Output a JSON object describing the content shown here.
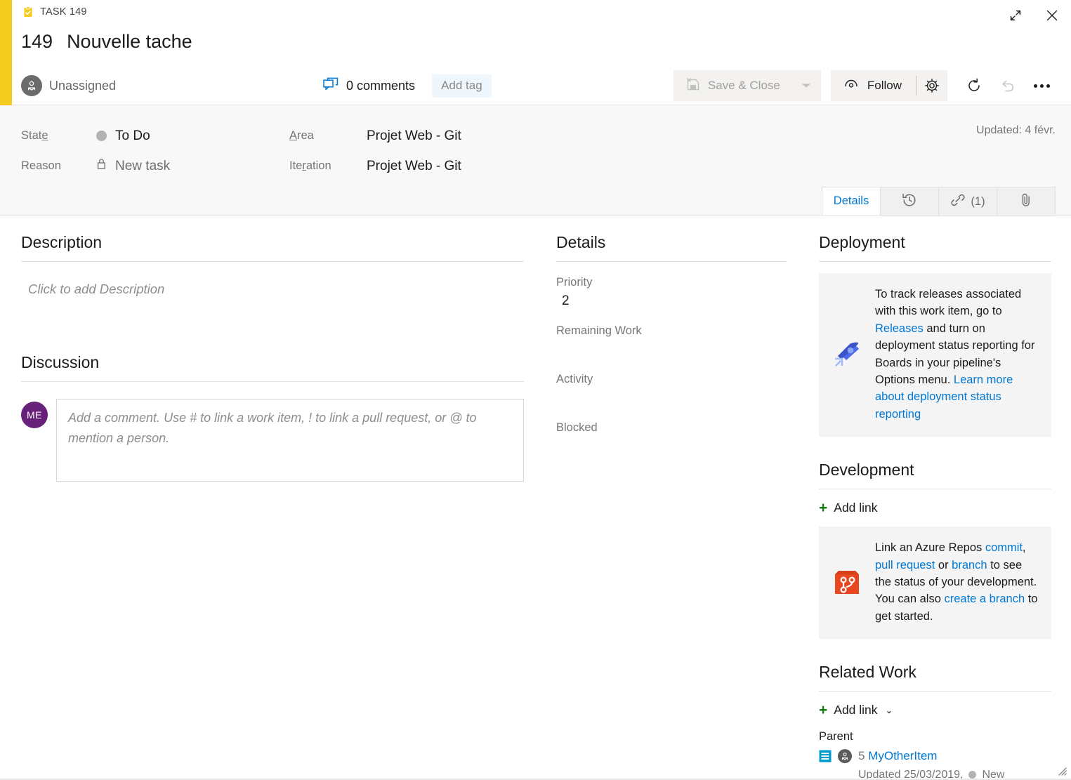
{
  "window": {
    "expand_title": "Expand",
    "close_title": "Close"
  },
  "header": {
    "work_item_type": "TASK 149",
    "id": "149",
    "title": "Nouvelle tache",
    "assigned_to": "Unassigned",
    "comments_label": "0 comments",
    "add_tag_label": "Add tag",
    "accent_color": "#f2cb1d"
  },
  "toolbar": {
    "save_close_label": "Save & Close",
    "save_close_disabled": true,
    "follow_label": "Follow",
    "gear_title": "Work item settings",
    "refresh_title": "Refresh",
    "undo_title": "Undo",
    "more_title": "More actions"
  },
  "fields": {
    "state_label": "State",
    "state_value": "To Do",
    "state_color": "#b2b2b2",
    "reason_label": "Reason",
    "reason_value": "New task",
    "area_label": "Area",
    "area_value": "Projet Web - Git",
    "iteration_label": "Iteration",
    "iteration_value": "Projet Web - Git",
    "updated_stamp": "Updated: 4 févr."
  },
  "tabs": [
    {
      "label": "Details",
      "icon": "",
      "active": true
    },
    {
      "label": "",
      "icon": "history-icon",
      "active": false
    },
    {
      "label": "(1)",
      "icon": "link-icon",
      "active": false
    },
    {
      "label": "",
      "icon": "attachment-icon",
      "active": false
    }
  ],
  "description": {
    "title": "Description",
    "placeholder": "Click to add Description"
  },
  "discussion": {
    "title": "Discussion",
    "avatar_initials": "ME",
    "comment_placeholder": "Add a comment. Use # to link a work item, ! to link a pull request, or @ to mention a person."
  },
  "details": {
    "title": "Details",
    "priority_label": "Priority",
    "priority_value": "2",
    "remaining_work_label": "Remaining Work",
    "remaining_work_value": "",
    "activity_label": "Activity",
    "activity_value": "",
    "blocked_label": "Blocked",
    "blocked_value": ""
  },
  "deployment": {
    "title": "Deployment",
    "text_1": "To track releases associated with this work item, go to ",
    "link_releases": "Releases",
    "text_2": " and turn on deployment status reporting for Boards in your pipeline's Options menu. ",
    "link_learn_more": "Learn more about deployment status reporting"
  },
  "development": {
    "title": "Development",
    "add_link_label": "Add link",
    "text_1": "Link an Azure Repos ",
    "link_commit": "commit",
    "text_2": ", ",
    "link_pull_request": "pull request",
    "text_3": " or ",
    "link_branch": "branch",
    "text_4": " to see the status of your development. You can also ",
    "link_create_branch": "create a branch",
    "text_5": " to get started."
  },
  "related_work": {
    "title": "Related Work",
    "add_link_label": "Add link",
    "parent_label": "Parent",
    "parent_id": "5",
    "parent_title": "MyOtherItem",
    "parent_updated": "Updated 25/03/2019,",
    "parent_state": "New",
    "parent_state_color": "#b2b2b2"
  },
  "colors": {
    "accent_link": "#0078d4",
    "add_green": "#107c10",
    "avatar_purple": "#68217a",
    "task_yellow": "#f2cb1d"
  }
}
